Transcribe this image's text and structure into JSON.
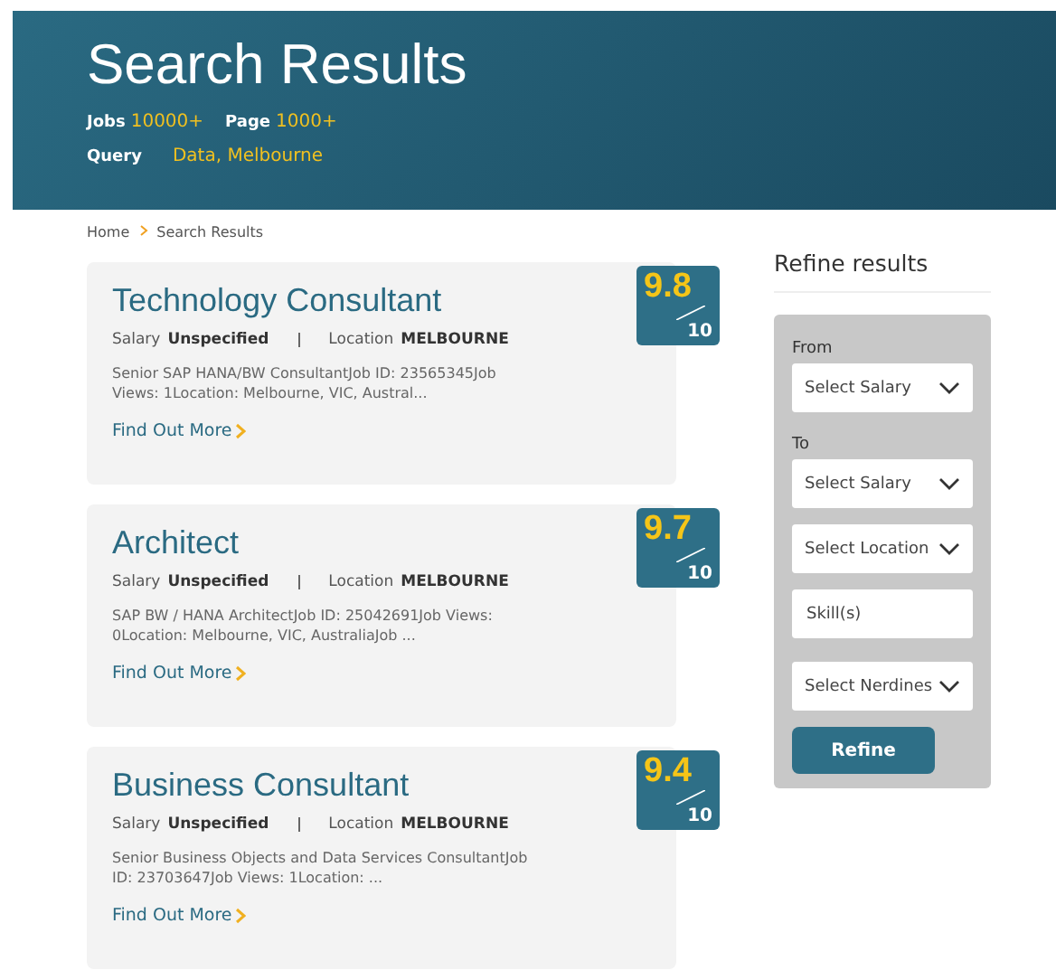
{
  "header": {
    "title": "Search Results",
    "stats": [
      {
        "label": "Jobs",
        "value": "10000+"
      },
      {
        "label": "Page",
        "value": "1000+"
      }
    ],
    "query": {
      "label": "Query",
      "value": "Data, Melbourne"
    }
  },
  "breadcrumb": [
    "Home",
    "Search Results"
  ],
  "jobs": [
    {
      "title": "Technology Consultant",
      "salary_label": "Salary",
      "salary": "Unspecified",
      "location_label": "Location",
      "location": "MELBOURNE",
      "snippet": "Senior SAP HANA/BW ConsultantJob ID: 23565345Job Views: 1Location: Melbourne, VIC, Austral...",
      "link": "Find Out More",
      "score": "9.8",
      "score_max": "10"
    },
    {
      "title": "Architect",
      "salary_label": "Salary",
      "salary": "Unspecified",
      "location_label": "Location",
      "location": "MELBOURNE",
      "snippet": "SAP BW / HANA ArchitectJob ID: 25042691Job Views: 0Location: Melbourne, VIC, AustraliaJob ...",
      "link": "Find Out More",
      "score": "9.7",
      "score_max": "10"
    },
    {
      "title": "Business Consultant",
      "salary_label": "Salary",
      "salary": "Unspecified",
      "location_label": "Location",
      "location": "MELBOURNE",
      "snippet": "Senior Business Objects and Data Services ConsultantJob ID: 23703647Job Views: 1Location: ...",
      "link": "Find Out More",
      "score": "9.4",
      "score_max": "10"
    }
  ],
  "sidebar": {
    "title": "Refine results",
    "filters": [
      {
        "kind": "label",
        "text": "From"
      },
      {
        "kind": "select",
        "text": "Select Salary"
      },
      {
        "kind": "label",
        "text": "To"
      },
      {
        "kind": "select",
        "text": "Select Salary"
      },
      {
        "kind": "select",
        "text": "Select Location"
      },
      {
        "kind": "input",
        "placeholder": "Skill(s)"
      },
      {
        "kind": "select",
        "text": "Select Nerdines"
      }
    ],
    "button": "Refine"
  }
}
